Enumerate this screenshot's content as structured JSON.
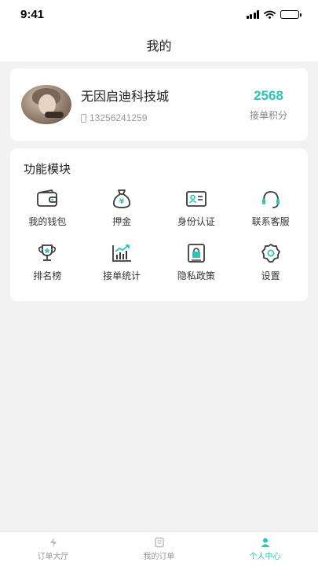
{
  "status_bar": {
    "time": "9:41"
  },
  "nav": {
    "title": "我的"
  },
  "profile": {
    "company_name": "无因启迪科技城",
    "phone": "13256241259",
    "points_value": "2568",
    "points_label": "接单积分"
  },
  "modules": {
    "title": "功能模块",
    "items": [
      {
        "label": "我的钱包",
        "icon": "wallet-icon"
      },
      {
        "label": "押金",
        "icon": "money-bag-icon"
      },
      {
        "label": "身份认证",
        "icon": "id-card-icon"
      },
      {
        "label": "联系客服",
        "icon": "headset-icon"
      },
      {
        "label": "排名榜",
        "icon": "trophy-icon"
      },
      {
        "label": "接单统计",
        "icon": "stats-chart-icon"
      },
      {
        "label": "隐私政策",
        "icon": "privacy-icon"
      },
      {
        "label": "设置",
        "icon": "gear-icon"
      }
    ]
  },
  "tabs": [
    {
      "label": "订单大厅",
      "icon": "lightning-icon",
      "active": false
    },
    {
      "label": "我的订单",
      "icon": "order-icon",
      "active": false
    },
    {
      "label": "个人中心",
      "icon": "person-icon",
      "active": true
    }
  ],
  "colors": {
    "accent": "#2ec4b6",
    "icon_stroke": "#3a3a3a",
    "background": "#f2f2f2"
  }
}
